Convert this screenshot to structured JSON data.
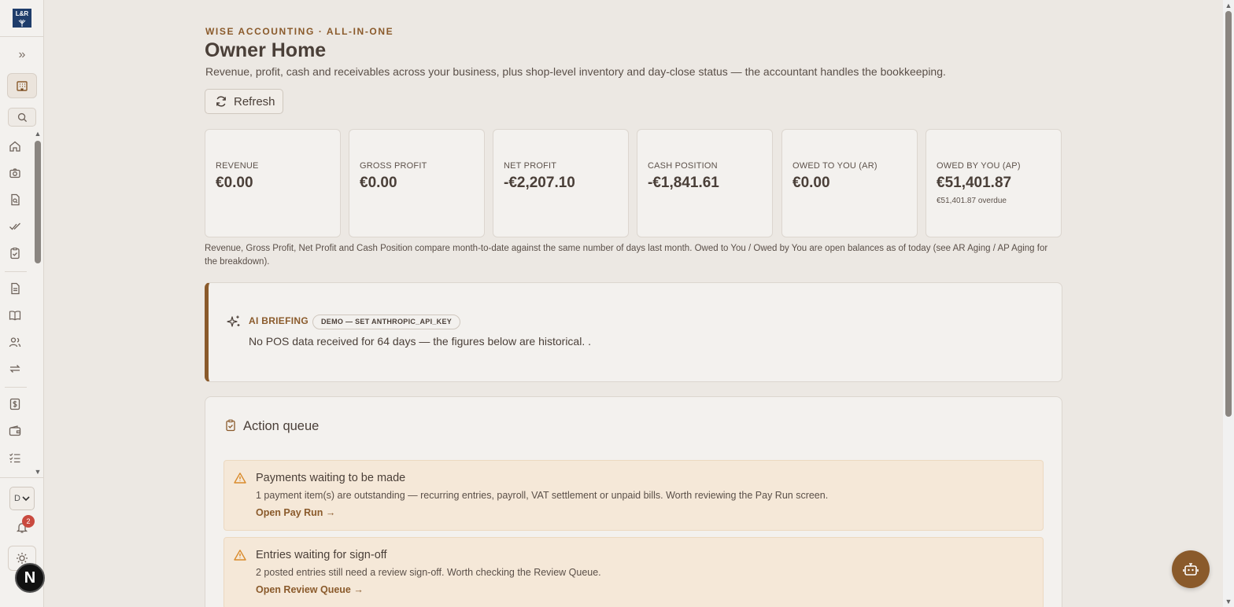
{
  "sidebar": {
    "logo_text": "L&R",
    "lang_select_value": "D",
    "notifications_count": "2",
    "user_initial": "N",
    "icons": [
      "home-icon",
      "camera-icon",
      "file-search-icon",
      "double-check-icon",
      "clipboard-check-icon",
      "document-icon",
      "book-open-icon",
      "users-icon",
      "transfer-icon",
      "dollar-doc-icon",
      "wallet-icon",
      "checklist-icon"
    ]
  },
  "header": {
    "eyebrow": "WISE ACCOUNTING · ALL-IN-ONE",
    "title": "Owner Home",
    "subtitle": "Revenue, profit, cash and receivables across your business, plus shop-level inventory and day-close status — the accountant handles the bookkeeping.",
    "refresh_label": "Refresh"
  },
  "kpis": [
    {
      "label": "REVENUE",
      "value": "€0.00",
      "sub": ""
    },
    {
      "label": "GROSS PROFIT",
      "value": "€0.00",
      "sub": ""
    },
    {
      "label": "NET PROFIT",
      "value": "-€2,207.10",
      "sub": ""
    },
    {
      "label": "CASH POSITION",
      "value": "-€1,841.61",
      "sub": ""
    },
    {
      "label": "OWED TO YOU (AR)",
      "value": "€0.00",
      "sub": ""
    },
    {
      "label": "OWED BY YOU (AP)",
      "value": "€51,401.87",
      "sub": "€51,401.87 overdue"
    }
  ],
  "kpi_note": "Revenue, Gross Profit, Net Profit and Cash Position compare month-to-date against the same number of days last month. Owed to You / Owed by You are open balances as of today (see AR Aging / AP Aging for the breakdown).",
  "briefing": {
    "title": "AI BRIEFING",
    "tag": "DEMO — SET ANTHROPIC_API_KEY",
    "text": "No POS data received for 64 days — the figures below are historical. ."
  },
  "action_queue": {
    "title": "Action queue",
    "items": [
      {
        "title": "Payments waiting to be made",
        "desc": "1 payment item(s) are outstanding — recurring entries, payroll, VAT settlement or unpaid bills. Worth reviewing the Pay Run screen.",
        "link": "Open Pay Run →"
      },
      {
        "title": "Entries waiting for sign-off",
        "desc": "2 posted entries still need a review sign-off. Worth checking the Review Queue.",
        "link": "Open Review Queue →"
      }
    ]
  },
  "colors": {
    "accent": "#8a5a2b",
    "background": "#ece8e3",
    "card": "#f3f1ee",
    "warning_bg": "#f5e8d8",
    "warning_icon": "#d98a2b",
    "badge": "#c94a3f"
  }
}
